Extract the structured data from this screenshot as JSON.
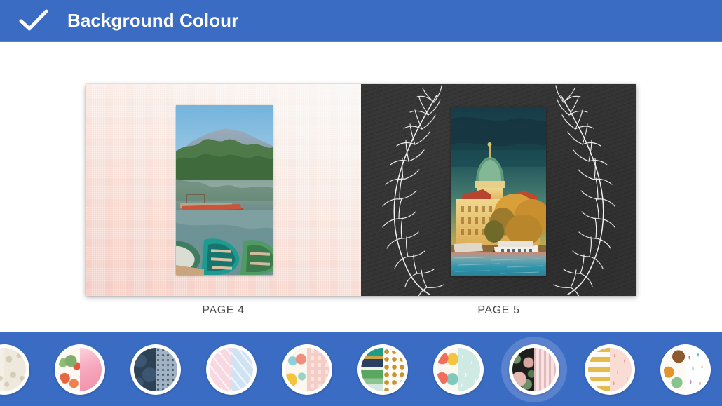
{
  "header": {
    "title": "Background Colour",
    "confirm_icon": "check-icon",
    "bar_color": "#3a6cc4",
    "title_color": "#ffffff"
  },
  "spread": {
    "pages": [
      {
        "caption": "PAGE 4",
        "background_name": "pink-watercolour-paper",
        "background_colors": [
          "#faf7f5",
          "#f4cdc4"
        ],
        "photo": {
          "name": "lake-canoes-photo",
          "description": "Mountain lake at sunrise with moored red rowboats and green canoes"
        },
        "decoration": "none"
      },
      {
        "caption": "PAGE 5",
        "background_name": "dark-chalkboard-laurel",
        "background_colors": [
          "#343434"
        ],
        "photo": {
          "name": "city-river-dome-photo",
          "description": "Golden-hour riverside cityscape with green dome, autumn trees and a ferry"
        },
        "decoration": "white-laurel-branches"
      }
    ]
  },
  "tray": {
    "background_color": "#3a6cc4",
    "selected_index": 7,
    "selected_halo_color": "#5a82cd",
    "swatches": [
      {
        "name": "cream-lace-floral",
        "left": {
          "base": "#f3efe7",
          "pattern": "lace-floral",
          "ink": "#d8d0c0"
        },
        "right": {
          "base": "#efe9dd",
          "pattern": "lace-floral",
          "ink": "#d5ccba"
        }
      },
      {
        "name": "watercolour-poppies-pink-wash",
        "left": {
          "base": "#fdf8f2",
          "pattern": "poppies",
          "ink": "#e8663f"
        },
        "right": {
          "base": "#f6a8bd",
          "pattern": "wash",
          "ink": "#ef8aa6"
        }
      },
      {
        "name": "navy-rose-navy-dots",
        "left": {
          "base": "#2e4255",
          "pattern": "rose-damask",
          "ink": "#3c5570"
        },
        "right": {
          "base": "#9fb3c4",
          "pattern": "dots",
          "ink": "#45586c"
        }
      },
      {
        "name": "pink-marble-blue-marble",
        "left": {
          "base": "#f8d9e2",
          "pattern": "marble",
          "ink": "#eeb3c5"
        },
        "right": {
          "base": "#cfe3f2",
          "pattern": "marble",
          "ink": "#a8cde8"
        }
      },
      {
        "name": "abstract-confetti-pink-gingham",
        "left": {
          "base": "#fbf6ee",
          "pattern": "confetti",
          "ink": "#f3c53f"
        },
        "right": {
          "base": "#fae4e0",
          "pattern": "gingham",
          "ink": "#f3cdc6"
        }
      },
      {
        "name": "colour-stripes-gold-dots",
        "left": {
          "base": "#1d9c86",
          "pattern": "stripes",
          "ink": "#2b3f63"
        },
        "right": {
          "base": "#fdfaf3",
          "pattern": "gold-dots",
          "ink": "#c8922f"
        }
      },
      {
        "name": "bold-dots-mint-speckle",
        "left": {
          "base": "#fcf8f0",
          "pattern": "big-dots",
          "ink": "#ef6f5c"
        },
        "right": {
          "base": "#cfeae3",
          "pattern": "speckle",
          "ink": "#ffffff"
        }
      },
      {
        "name": "dark-floral-pink-stripe",
        "left": {
          "base": "#1d1f1c",
          "pattern": "dark-floral",
          "ink": "#e8b9b2"
        },
        "right": {
          "base": "#f6e2e2",
          "pattern": "vertical-stripe",
          "ink": "#e3b9b9"
        }
      },
      {
        "name": "gold-stripe-pink-sprinkle",
        "left": {
          "base": "#f7f3ea",
          "pattern": "gold-stripes",
          "ink": "#e3bb4e"
        },
        "right": {
          "base": "#f9ddd4",
          "pattern": "sprinkle",
          "ink": "#e79a8c"
        }
      },
      {
        "name": "donuts-sprinkles",
        "left": {
          "base": "#fdfaf4",
          "pattern": "donuts",
          "ink": "#c98a53"
        },
        "right": {
          "base": "#ffffff",
          "pattern": "sprinkles",
          "ink": "#76c7a8"
        }
      }
    ]
  }
}
